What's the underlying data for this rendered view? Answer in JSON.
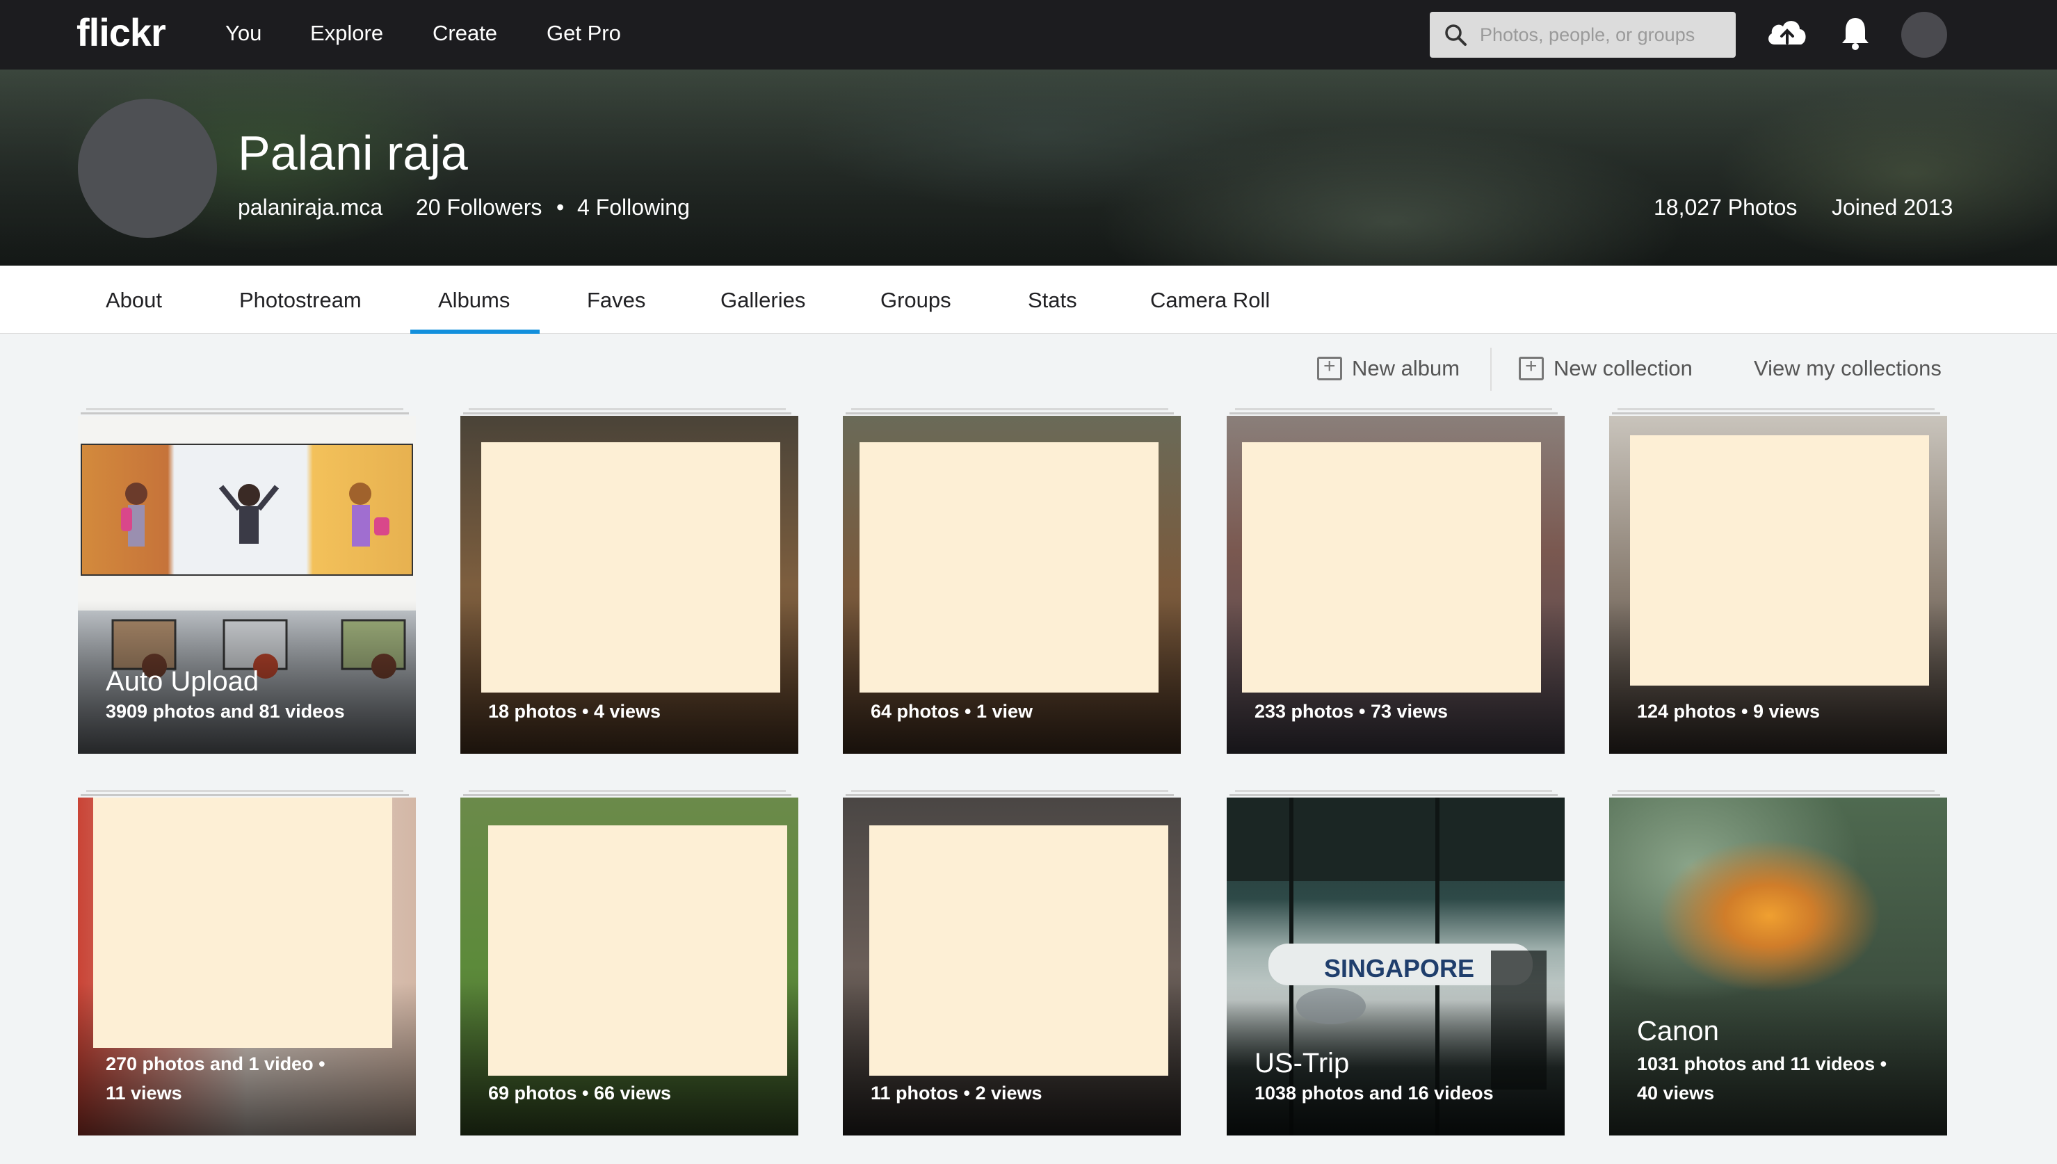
{
  "header": {
    "logo": "flickr",
    "nav": [
      "You",
      "Explore",
      "Create",
      "Get Pro"
    ],
    "search_placeholder": "Photos, people, or groups"
  },
  "profile": {
    "name": "Palani raja",
    "username": "palaniraja.mca",
    "followers": "20 Followers",
    "following": "4 Following",
    "photos": "18,027 Photos",
    "joined": "Joined 2013"
  },
  "tabs": [
    "About",
    "Photostream",
    "Albums",
    "Faves",
    "Galleries",
    "Groups",
    "Stats",
    "Camera Roll"
  ],
  "active_tab": "Albums",
  "actions": {
    "new_album": "New album",
    "new_collection": "New collection",
    "view_collections": "View my collections"
  },
  "albums": [
    {
      "title": "Auto Upload",
      "info": "3909 photos and 81 videos"
    },
    {
      "title": "",
      "info": "18 photos  •  4 views"
    },
    {
      "title": "",
      "info": "64 photos  •  1 view"
    },
    {
      "title": "",
      "info": "233 photos  •  73 views"
    },
    {
      "title": "",
      "info": "124 photos  •  9 views"
    },
    {
      "title": "",
      "info": "270 photos and 1 video  •",
      "info2": "11 views"
    },
    {
      "title": "",
      "info": "69 photos  •  66 views"
    },
    {
      "title": "",
      "info": "11 photos  •  2 views"
    },
    {
      "title": "US-Trip",
      "info": "1038 photos and 16 videos"
    },
    {
      "title": "Canon",
      "info": "1031 photos and 11 videos  •",
      "info2": "40 views"
    }
  ],
  "colors": {
    "accent": "#128fdc",
    "topbar": "#1c1c1f",
    "placeholder": "#fdefd5"
  }
}
